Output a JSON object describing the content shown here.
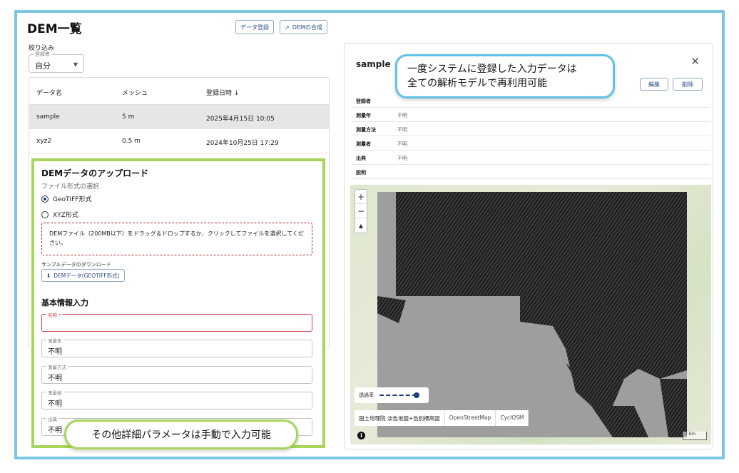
{
  "header": {
    "title": "DEM一覧",
    "data_register_label": "データ登録",
    "dem_composite_label": "DEMの合成"
  },
  "filter": {
    "label": "絞り込み",
    "select_legend": "登録者",
    "select_value": "自分"
  },
  "table": {
    "columns": [
      "データ名",
      "メッシュ",
      "登録日時 ↓"
    ],
    "rows": [
      {
        "name": "sample",
        "mesh": "5 m",
        "date": "2025年4月15日 10:05"
      },
      {
        "name": "xyz2",
        "mesh": "0.5 m",
        "date": "2024年10月25日 17:29"
      }
    ]
  },
  "upload": {
    "title": "DEMデータのアップロード",
    "format_label": "ファイル形式の選択",
    "options": [
      "GeoTIFF形式",
      "XYZ形式"
    ],
    "dropzone_text": "DEMファイル（200MB以下）をドラッグ＆ドロップするか、クリックしてファイルを選択してください。",
    "sample_label": "サンプルデータのダウンロード",
    "sample_button": "DEMデータ(GEOTIFF形式)",
    "basic_info_title": "基本情報入力",
    "fields": [
      {
        "label": "名称 *",
        "value": ""
      },
      {
        "label": "測量年",
        "value": "不明"
      },
      {
        "label": "測量方法",
        "value": "不明"
      },
      {
        "label": "測量者",
        "value": "不明"
      },
      {
        "label": "出典",
        "value": "不明"
      }
    ]
  },
  "detail": {
    "title": "sample",
    "edit_label": "編集",
    "delete_label": "削除",
    "props": [
      {
        "key": "登録者",
        "value": ""
      },
      {
        "key": "測量年",
        "value": "不明"
      },
      {
        "key": "測量方法",
        "value": "不明"
      },
      {
        "key": "測量者",
        "value": "不明"
      },
      {
        "key": "出典",
        "value": "不明"
      },
      {
        "key": "説明",
        "value": ""
      }
    ]
  },
  "map": {
    "zoom_in": "+",
    "zoom_out": "−",
    "compass": "▲",
    "opacity_label": "透過率",
    "layers": [
      "国土地理院 淡色地図+色別標高図",
      "OpenStreetMap",
      "CyclOSM"
    ],
    "scale_label": "2 km",
    "info": "i"
  },
  "callouts": {
    "top_right": [
      "一度システムに登録した入力データは",
      "全ての解析モデルで再利用可能"
    ],
    "bottom": "その他詳細パラメータは手動で入力可能"
  }
}
